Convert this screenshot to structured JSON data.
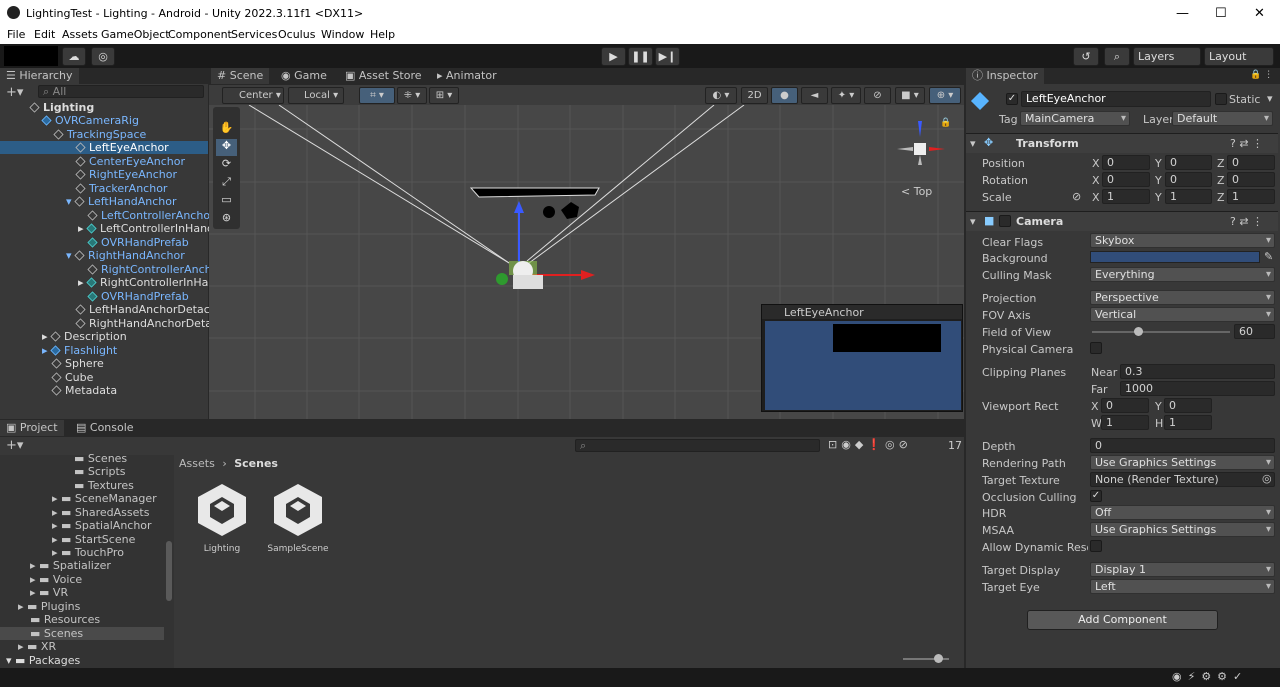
{
  "window": {
    "title": "LightingTest - Lighting - Android - Unity 2022.3.11f1 <DX11>"
  },
  "menu": [
    "File",
    "Edit",
    "Assets",
    "GameObject",
    "Component",
    "Services",
    "Oculus",
    "Window",
    "Help"
  ],
  "toolbar": {
    "layers": "Layers",
    "layout": "Layout"
  },
  "hierarchy": {
    "tab": "Hierarchy",
    "search_placeholder": "All",
    "items": [
      "Lighting",
      "OVRCameraRig",
      "TrackingSpace",
      "LeftEyeAnchor",
      "CenterEyeAnchor",
      "RightEyeAnchor",
      "TrackerAnchor",
      "LeftHandAnchor",
      "LeftControllerAnchor",
      "LeftControllerInHandA",
      "OVRHandPrefab",
      "RightHandAnchor",
      "RightControllerAnchor",
      "RightControllerInHand",
      "OVRHandPrefab",
      "LeftHandAnchorDetache",
      "RightHandAnchorDetach",
      "Description",
      "Flashlight",
      "Sphere",
      "Cube",
      "Metadata"
    ]
  },
  "scene": {
    "tabs": [
      "Scene",
      "Game",
      "Asset Store",
      "Animator"
    ],
    "pivot": "Center",
    "space": "Local",
    "mode2d": "2D",
    "gizmo_label": "Top",
    "camera_preview_title": "LeftEyeAnchor"
  },
  "project": {
    "tabs": [
      "Project",
      "Console"
    ],
    "breadcrumb_root": "Assets",
    "breadcrumb_current": "Scenes",
    "count": "17",
    "tree": [
      "Scenes",
      "Scripts",
      "Textures",
      "SceneManager",
      "SharedAssets",
      "SpatialAnchor",
      "StartScene",
      "TouchPro",
      "Spatializer",
      "Voice",
      "VR",
      "Plugins",
      "Resources",
      "Scenes",
      "XR",
      "Packages"
    ],
    "assets": [
      "Lighting",
      "SampleScene"
    ]
  },
  "inspector": {
    "tab": "Inspector",
    "object_name": "LeftEyeAnchor",
    "static_label": "Static",
    "tag_label": "Tag",
    "tag": "MainCamera",
    "layer_label": "Layer",
    "layer": "Default",
    "transform": {
      "title": "Transform",
      "position_label": "Position",
      "rotation_label": "Rotation",
      "scale_label": "Scale",
      "pos": [
        "0",
        "0",
        "0"
      ],
      "rot": [
        "0",
        "0",
        "0"
      ],
      "scale": [
        "1",
        "1",
        "1"
      ],
      "x": "X",
      "y": "Y",
      "z": "Z"
    },
    "camera": {
      "title": "Camera",
      "clear_flags_label": "Clear Flags",
      "clear_flags": "Skybox",
      "background_label": "Background",
      "background_color": "#314d79",
      "culling_label": "Culling Mask",
      "culling": "Everything",
      "projection_label": "Projection",
      "projection": "Perspective",
      "fov_axis_label": "FOV Axis",
      "fov_axis": "Vertical",
      "fov_label": "Field of View",
      "fov": "60",
      "physical_label": "Physical Camera",
      "clipping_label": "Clipping Planes",
      "near_label": "Near",
      "near": "0.3",
      "far_label": "Far",
      "far": "1000",
      "viewport_label": "Viewport Rect",
      "vx_label": "X",
      "vx": "0",
      "vy_label": "Y",
      "vy": "0",
      "vw_label": "W",
      "vw": "1",
      "vh_label": "H",
      "vh": "1",
      "depth_label": "Depth",
      "depth": "0",
      "render_path_label": "Rendering Path",
      "render_path": "Use Graphics Settings",
      "target_tex_label": "Target Texture",
      "target_tex": "None (Render Texture)",
      "occlusion_label": "Occlusion Culling",
      "hdr_label": "HDR",
      "hdr": "Off",
      "msaa_label": "MSAA",
      "msaa": "Use Graphics Settings",
      "dyn_label": "Allow Dynamic Resolut",
      "display_label": "Target Display",
      "display": "Display 1",
      "eye_label": "Target Eye",
      "eye": "Left"
    },
    "add_component": "Add Component"
  }
}
